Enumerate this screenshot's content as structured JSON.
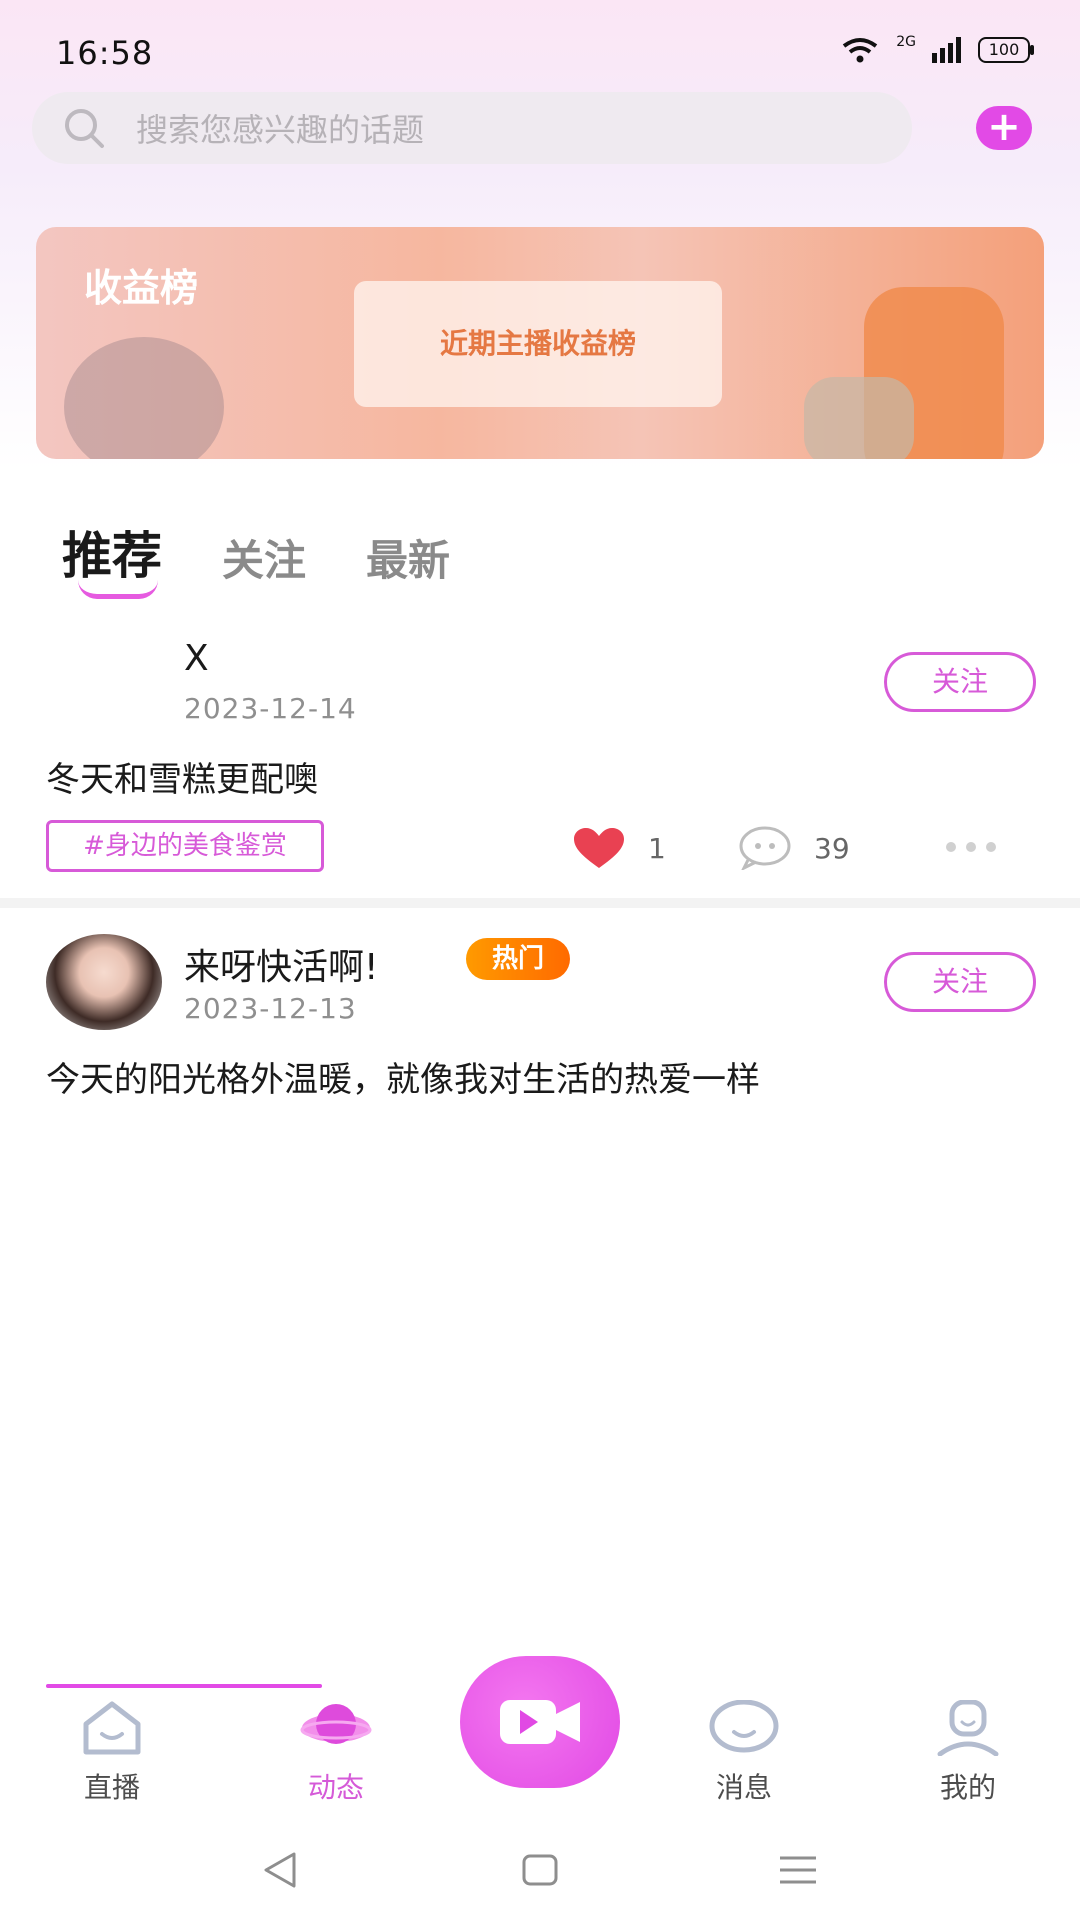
{
  "status_bar": {
    "time": "16:58",
    "battery": "100",
    "network": "2G"
  },
  "search": {
    "placeholder": "搜索您感兴趣的话题"
  },
  "banner": {
    "title": "收益榜",
    "card_text": "近期主播收益榜"
  },
  "tabs": [
    {
      "label": "推荐",
      "active": true
    },
    {
      "label": "关注",
      "active": false
    },
    {
      "label": "最新",
      "active": false
    }
  ],
  "posts": [
    {
      "username": "X",
      "date": "2023-12-14",
      "follow_label": "关注",
      "content": "冬天和雪糕更配噢",
      "topic": "#身边的美食鉴赏",
      "likes": "1",
      "comments": "39"
    },
    {
      "username": "来呀快活啊!",
      "badge": "热门",
      "date": "2023-12-13",
      "follow_label": "关注",
      "content": "今天的阳光格外温暖，就像我对生活的热爱一样"
    }
  ],
  "tabbar": [
    {
      "label": "直播",
      "icon": "home-icon"
    },
    {
      "label": "动态",
      "icon": "planet-icon",
      "active": true
    },
    {
      "label": "",
      "icon": "video-camera-icon"
    },
    {
      "label": "消息",
      "icon": "chat-bubble-icon"
    },
    {
      "label": "我的",
      "icon": "person-icon"
    }
  ],
  "colors": {
    "accent": "#e24ae6",
    "hot": "#ff7a00"
  }
}
